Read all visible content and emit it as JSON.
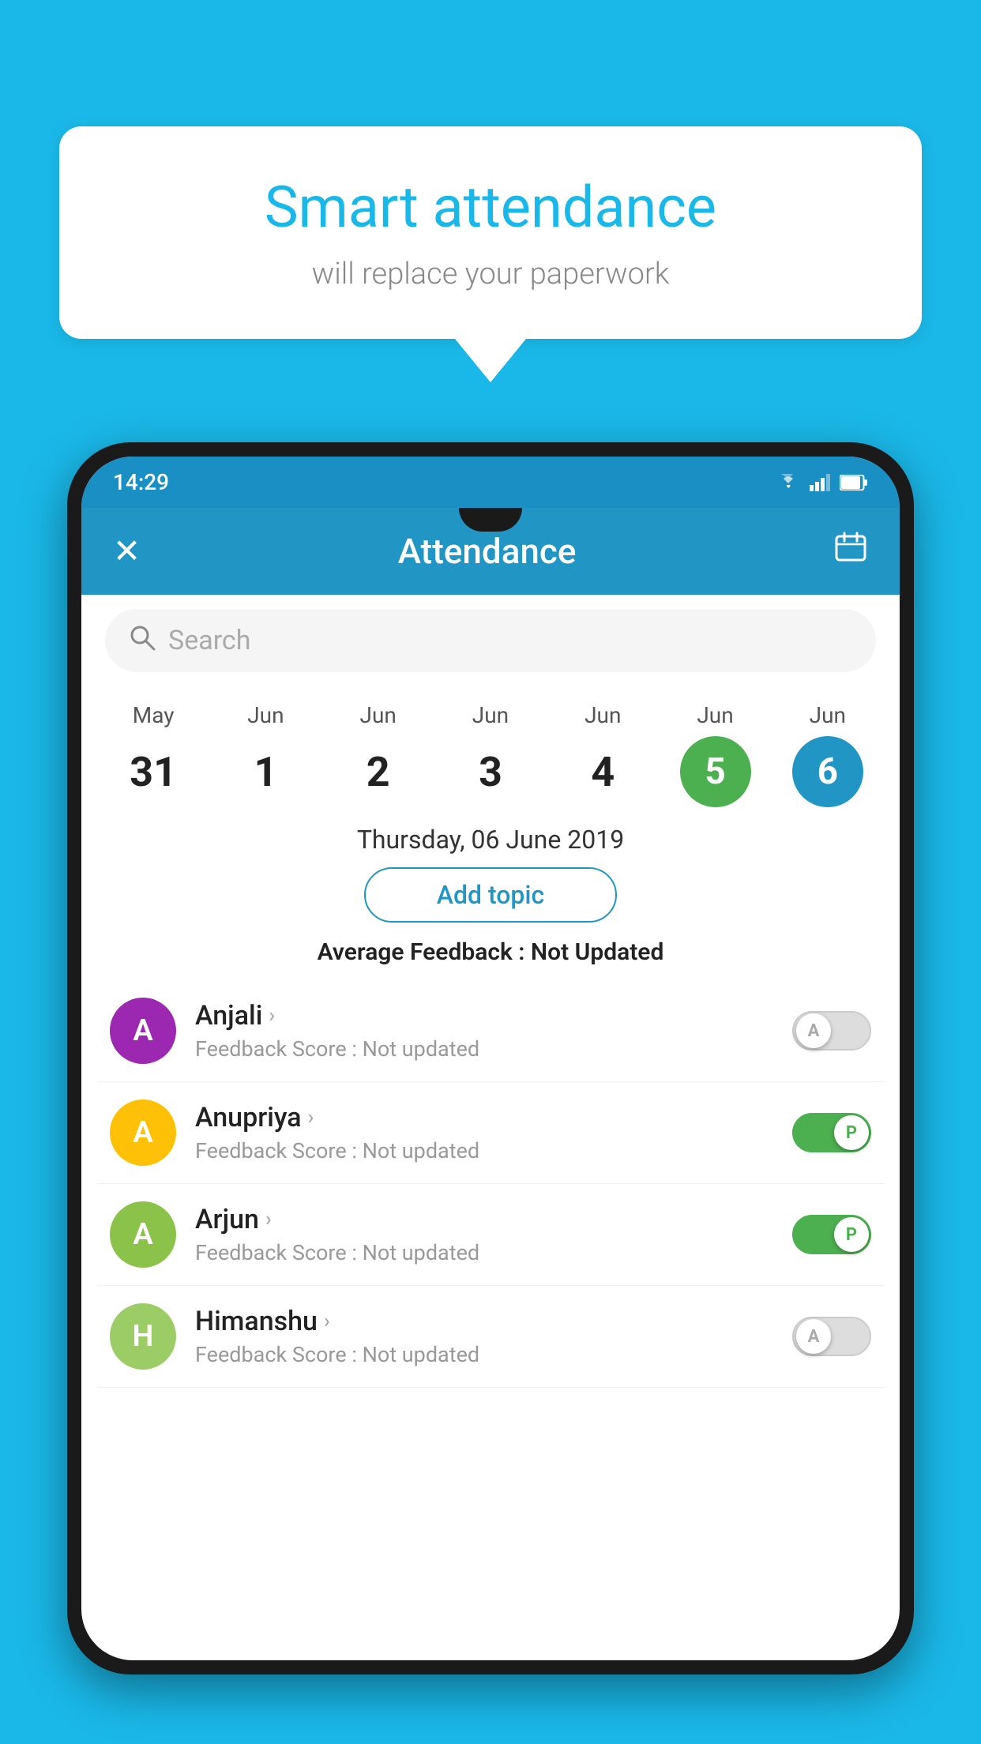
{
  "background_color": "#1ab8e8",
  "bubble": {
    "title": "Smart attendance",
    "subtitle": "will replace your paperwork"
  },
  "phone": {
    "status_bar": {
      "time": "14:29",
      "wifi_icon": "wifi",
      "signal_icon": "signal",
      "battery_icon": "battery"
    },
    "app_bar": {
      "close_icon": "✕",
      "title": "Attendance",
      "calendar_icon": "📅"
    },
    "search": {
      "placeholder": "Search",
      "icon": "🔍"
    },
    "calendar": {
      "days": [
        {
          "month": "May",
          "date": "31",
          "style": "normal"
        },
        {
          "month": "Jun",
          "date": "1",
          "style": "normal"
        },
        {
          "month": "Jun",
          "date": "2",
          "style": "normal"
        },
        {
          "month": "Jun",
          "date": "3",
          "style": "normal"
        },
        {
          "month": "Jun",
          "date": "4",
          "style": "normal"
        },
        {
          "month": "Jun",
          "date": "5",
          "style": "green"
        },
        {
          "month": "Jun",
          "date": "6",
          "style": "blue"
        }
      ]
    },
    "selected_date": "Thursday, 06 June 2019",
    "add_topic_label": "Add topic",
    "avg_feedback_label": "Average Feedback : ",
    "avg_feedback_value": "Not Updated",
    "students": [
      {
        "name": "Anjali",
        "avatar_letter": "A",
        "avatar_color": "purple",
        "feedback": "Not updated",
        "toggle": "off"
      },
      {
        "name": "Anupriya",
        "avatar_letter": "A",
        "avatar_color": "yellow",
        "feedback": "Not updated",
        "toggle": "on"
      },
      {
        "name": "Arjun",
        "avatar_letter": "A",
        "avatar_color": "light-green",
        "feedback": "Not updated",
        "toggle": "on"
      },
      {
        "name": "Himanshu",
        "avatar_letter": "H",
        "avatar_color": "olive",
        "feedback": "Not updated",
        "toggle": "off"
      }
    ],
    "feedback_score_label": "Feedback Score : "
  }
}
